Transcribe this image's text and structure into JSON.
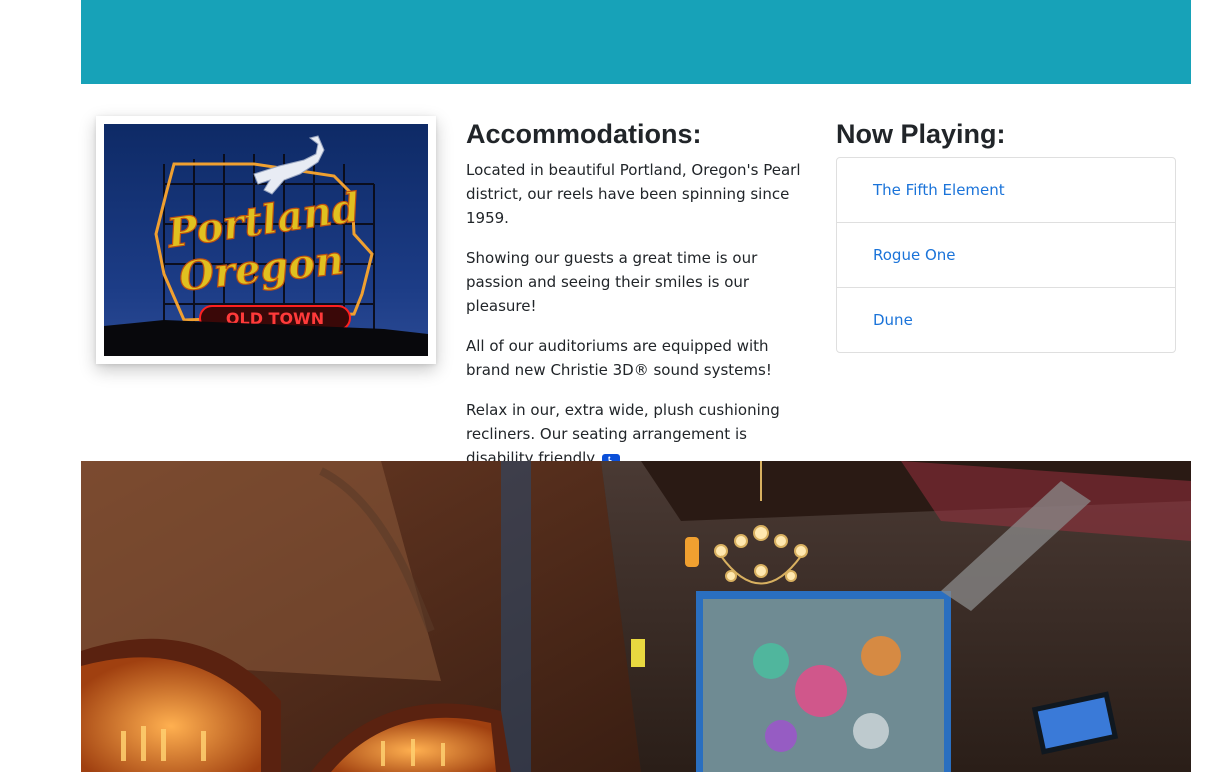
{
  "header": {
    "banner_color": "#17a2b8"
  },
  "sign_photo": {
    "line1": "Portland",
    "line2": "Oregon",
    "line3": "OLD TOWN"
  },
  "accommodations": {
    "title": "Accommodations:",
    "paragraphs": [
      "Located in beautiful Portland, Oregon's Pearl district, our reels have been spinning since 1959.",
      "Showing our guests a great time is our passion and seeing their smiles is our pleasure!",
      "All of our auditoriums are equipped with brand new Christie 3D® sound systems!",
      "Relax in our, extra wide, plush cushioning recliners. Our seating arrangement is disability friendly"
    ],
    "final_punctuation": ".",
    "accessibility_icon": "wheelchair-icon",
    "accessibility_glyph": "♿"
  },
  "now_playing": {
    "title": "Now Playing:",
    "movies": [
      "The Fifth Element",
      "Rogue One",
      "Dune"
    ],
    "link_color": "#1a73d9"
  },
  "venue_photo": {
    "mural_color": "#2a6fc0"
  }
}
